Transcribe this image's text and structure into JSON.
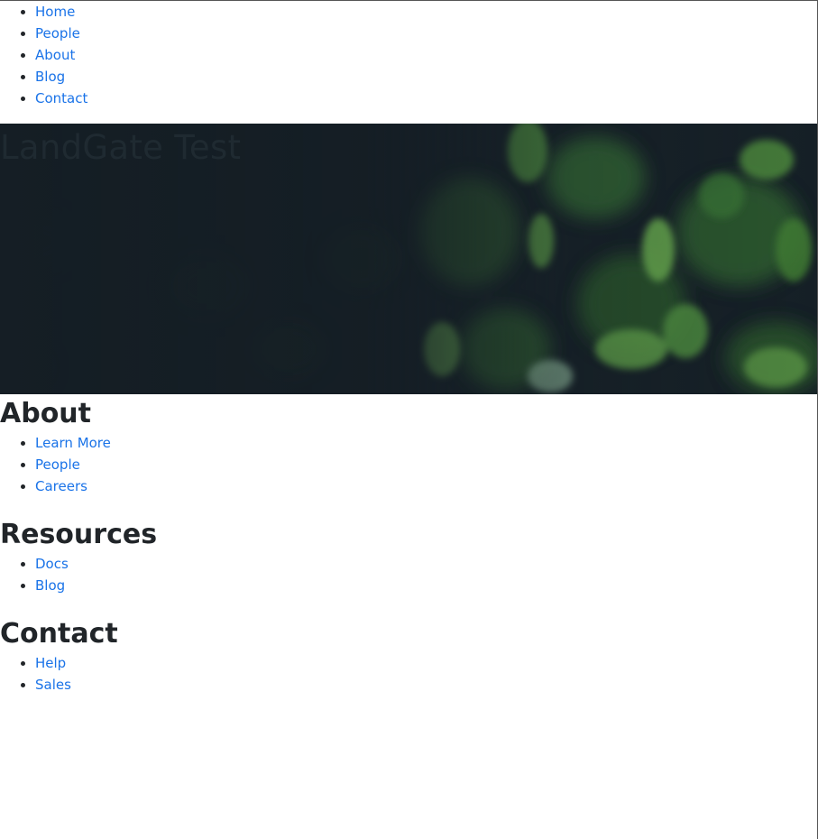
{
  "nav": {
    "items": [
      {
        "label": "Home"
      },
      {
        "label": "People"
      },
      {
        "label": "About"
      },
      {
        "label": "Blog"
      },
      {
        "label": "Contact"
      }
    ]
  },
  "hero": {
    "title": "LandGate Test",
    "image": "blurred-green-leaves"
  },
  "footer": {
    "sections": [
      {
        "heading": "About",
        "links": [
          {
            "label": "Learn More"
          },
          {
            "label": "People"
          },
          {
            "label": "Careers"
          }
        ]
      },
      {
        "heading": "Resources",
        "links": [
          {
            "label": "Docs"
          },
          {
            "label": "Blog"
          }
        ]
      },
      {
        "heading": "Contact",
        "links": [
          {
            "label": "Help"
          },
          {
            "label": "Sales"
          }
        ]
      }
    ]
  },
  "colors": {
    "link": "#1a73e8",
    "text": "#212529",
    "hero_bg": "#172028"
  }
}
